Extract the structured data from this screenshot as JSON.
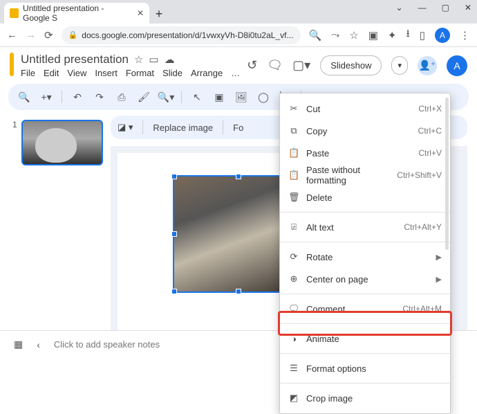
{
  "browser": {
    "tab_title": "Untitled presentation - Google S",
    "url": "docs.google.com/presentation/d/1vwxyVh-D8i0tu2aL_vf...",
    "avatar_letter": "A"
  },
  "app": {
    "title": "Untitled presentation",
    "menus": [
      "File",
      "Edit",
      "View",
      "Insert",
      "Format",
      "Slide",
      "Arrange",
      "…"
    ],
    "slideshow_label": "Slideshow",
    "avatar_letter": "A"
  },
  "subtoolbar": {
    "replace_label": "Replace image",
    "format_short": "Fo"
  },
  "thumb": {
    "number": "1"
  },
  "notes": {
    "placeholder": "Click to add speaker notes"
  },
  "context_menu": {
    "cut": {
      "label": "Cut",
      "shortcut": "Ctrl+X"
    },
    "copy": {
      "label": "Copy",
      "shortcut": "Ctrl+C"
    },
    "paste": {
      "label": "Paste",
      "shortcut": "Ctrl+V"
    },
    "paste_wo": {
      "label": "Paste without formatting",
      "shortcut": "Ctrl+Shift+V"
    },
    "delete": {
      "label": "Delete"
    },
    "alt": {
      "label": "Alt text",
      "shortcut": "Ctrl+Alt+Y"
    },
    "rotate": {
      "label": "Rotate"
    },
    "center": {
      "label": "Center on page"
    },
    "comment": {
      "label": "Comment",
      "shortcut": "Ctrl+Alt+M"
    },
    "animate": {
      "label": "Animate"
    },
    "format_options": {
      "label": "Format options"
    },
    "crop": {
      "label": "Crop image"
    }
  }
}
